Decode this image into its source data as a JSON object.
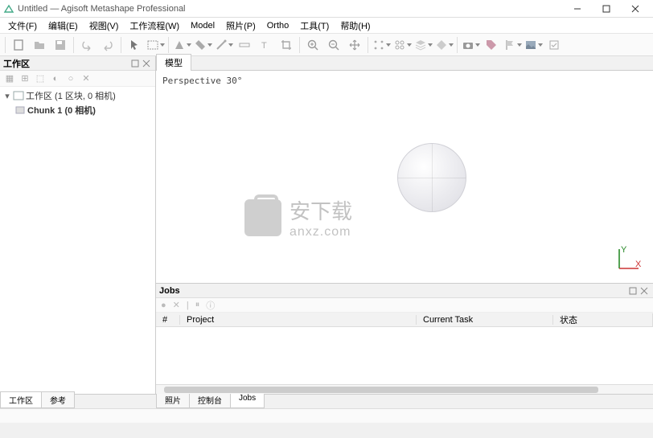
{
  "window": {
    "title": "Untitled — Agisoft Metashape Professional"
  },
  "menu": {
    "file": "文件(F)",
    "edit": "编辑(E)",
    "view": "视图(V)",
    "workflow": "工作流程(W)",
    "model": "Model",
    "photo": "照片(P)",
    "ortho": "Ortho",
    "tools": "工具(T)",
    "help": "帮助(H)"
  },
  "workspace": {
    "title": "工作区",
    "root": "工作区 (1 区块, 0 相机)",
    "chunk": "Chunk 1 (0 相机)"
  },
  "viewport": {
    "tab": "模型",
    "perspective_label": "Perspective 30°",
    "axis_x": "X",
    "axis_y": "Y"
  },
  "jobs": {
    "title": "Jobs",
    "columns": {
      "idx": "#",
      "project": "Project",
      "task": "Current Task",
      "status": "状态"
    }
  },
  "bottom_tabs": {
    "left": {
      "workspace": "工作区",
      "reference": "参考"
    },
    "right": {
      "photos": "照片",
      "console": "控制台",
      "jobs": "Jobs"
    }
  },
  "watermark": {
    "line1": "安下载",
    "line2": "anxz.com"
  }
}
